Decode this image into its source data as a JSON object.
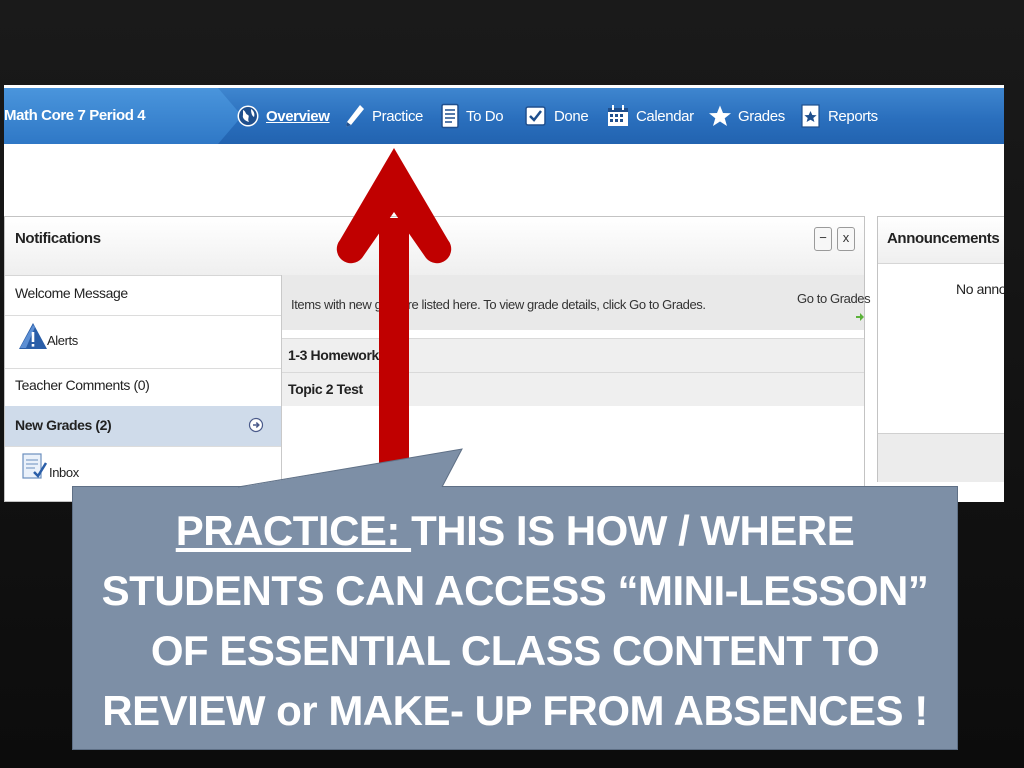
{
  "navbar": {
    "class_title": "Math Core 7 Period 4",
    "items": [
      {
        "label": "Overview",
        "icon": "globe-icon",
        "active": true
      },
      {
        "label": "Practice",
        "icon": "pencil-icon"
      },
      {
        "label": "To Do",
        "icon": "document-icon"
      },
      {
        "label": "Done",
        "icon": "checkbox-icon"
      },
      {
        "label": "Calendar",
        "icon": "calendar-icon"
      },
      {
        "label": "Grades",
        "icon": "star-icon"
      },
      {
        "label": "Reports",
        "icon": "report-icon"
      }
    ]
  },
  "notifications": {
    "title": "Notifications",
    "minimize": "−",
    "close": "x",
    "side_items": [
      {
        "label": "Welcome Message"
      },
      {
        "label": "Alerts",
        "icon": "alert-icon"
      },
      {
        "label": "Teacher Comments (0)"
      },
      {
        "label": "New Grades (2)",
        "selected": true
      },
      {
        "label": "Inbox",
        "icon": "inbox-icon"
      }
    ],
    "info_text": "Items with new g      are listed here. To view grade details, click Go to Grades.",
    "go_to_grades": "Go to Grades",
    "grades": [
      "1-3 Homework",
      "Topic 2 Test"
    ]
  },
  "announcements": {
    "title": "Announcements",
    "body": "No anno"
  },
  "callout": {
    "underlined": "PRACTICE: ",
    "rest": "THIS IS HOW / WHERE STUDENTS CAN ACCESS “MINI-LESSON” OF ESSENTIAL CLASS CONTENT TO REVIEW or MAKE- UP FROM ABSENCES !"
  },
  "colors": {
    "nav_blue": "#2a6fbd",
    "arrow_red": "#c00000",
    "callout_bg": "#7d8fa6",
    "selected_row": "#cfdbea"
  }
}
